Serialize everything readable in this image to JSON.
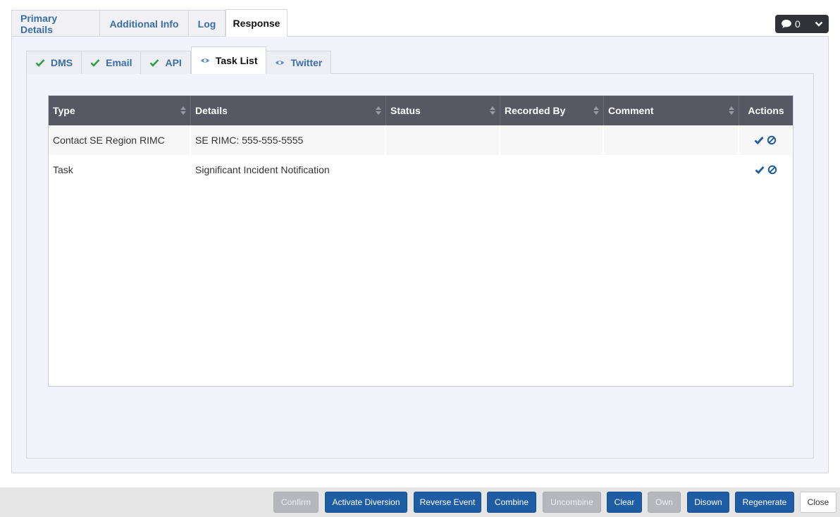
{
  "top_tabs": [
    {
      "label": "Primary Details",
      "active": false
    },
    {
      "label": "Additional Info",
      "active": false
    },
    {
      "label": "Log",
      "active": false
    },
    {
      "label": "Response",
      "active": true
    }
  ],
  "comments": {
    "count": "0"
  },
  "sub_tabs": [
    {
      "label": "DMS",
      "icon": "check-icon"
    },
    {
      "label": "Email",
      "icon": "check-icon"
    },
    {
      "label": "API",
      "icon": "check-icon"
    },
    {
      "label": "Task List",
      "icon": "eye-icon",
      "active": true
    },
    {
      "label": "Twitter",
      "icon": "eye-icon"
    }
  ],
  "table": {
    "headers": [
      "Type",
      "Details",
      "Status",
      "Recorded By",
      "Comment",
      "Actions"
    ],
    "rows": [
      {
        "type": "Contact SE Region RIMC",
        "details": "SE RIMC: 555-555-5555",
        "status": "",
        "recorded_by": "",
        "comment": ""
      },
      {
        "type": "Task",
        "details": "Significant Incident Notification",
        "status": "",
        "recorded_by": "",
        "comment": ""
      }
    ]
  },
  "buttons": {
    "confirm": "Confirm",
    "activate_diversion": "Activate Diversion",
    "reverse_event": "Reverse Event",
    "combine": "Combine",
    "uncombine": "Uncombine",
    "clear": "Clear",
    "own": "Own",
    "disown": "Disown",
    "regenerate": "Regenerate",
    "close": "Close"
  },
  "colors": {
    "accent": "#1e5da4",
    "check": "#2e9e4a",
    "eye": "#5f8fd6",
    "header_bg": "#575863"
  }
}
